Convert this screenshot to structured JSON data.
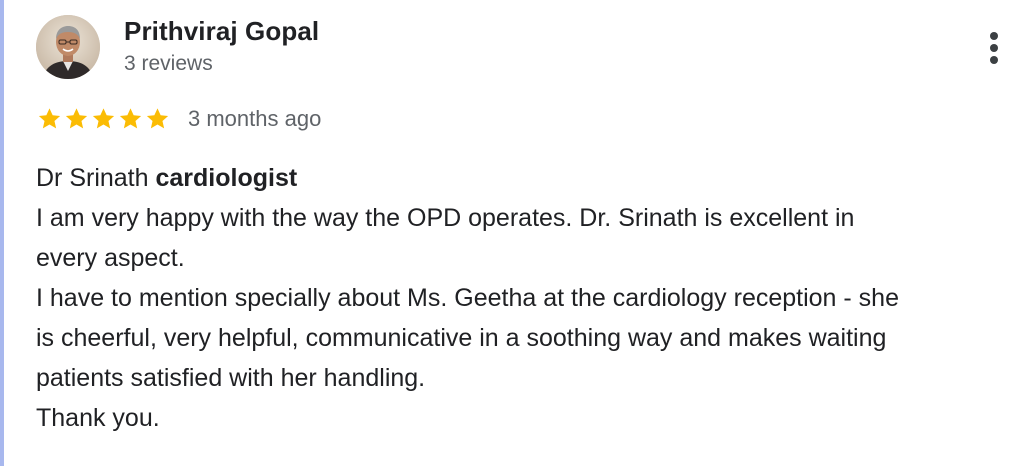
{
  "reviewer": {
    "name": "Prithviraj Gopal",
    "reviews_count": "3 reviews",
    "avatar_icon": "person-photo-icon"
  },
  "menu": {
    "icon": "more-vertical-icon"
  },
  "rating": {
    "stars": 5,
    "max_stars": 5,
    "star_color": "#fbbc04",
    "date": "3 months ago"
  },
  "review": {
    "title_prefix": "Dr Srinath ",
    "title_bold": "cardiologist",
    "lines": [
      "I am very happy with the way the OPD operates. Dr. Srinath is excellent in",
      "every aspect.",
      "I have to mention specially about Ms. Geetha at the cardiology reception - she",
      "is cheerful, very helpful, communicative in a soothing way and makes waiting",
      "patients satisfied with her handling.",
      "Thank you."
    ]
  },
  "colors": {
    "accent_left_rule": "#a8b8ee",
    "text_primary": "#202124",
    "text_secondary": "#5f6368"
  }
}
